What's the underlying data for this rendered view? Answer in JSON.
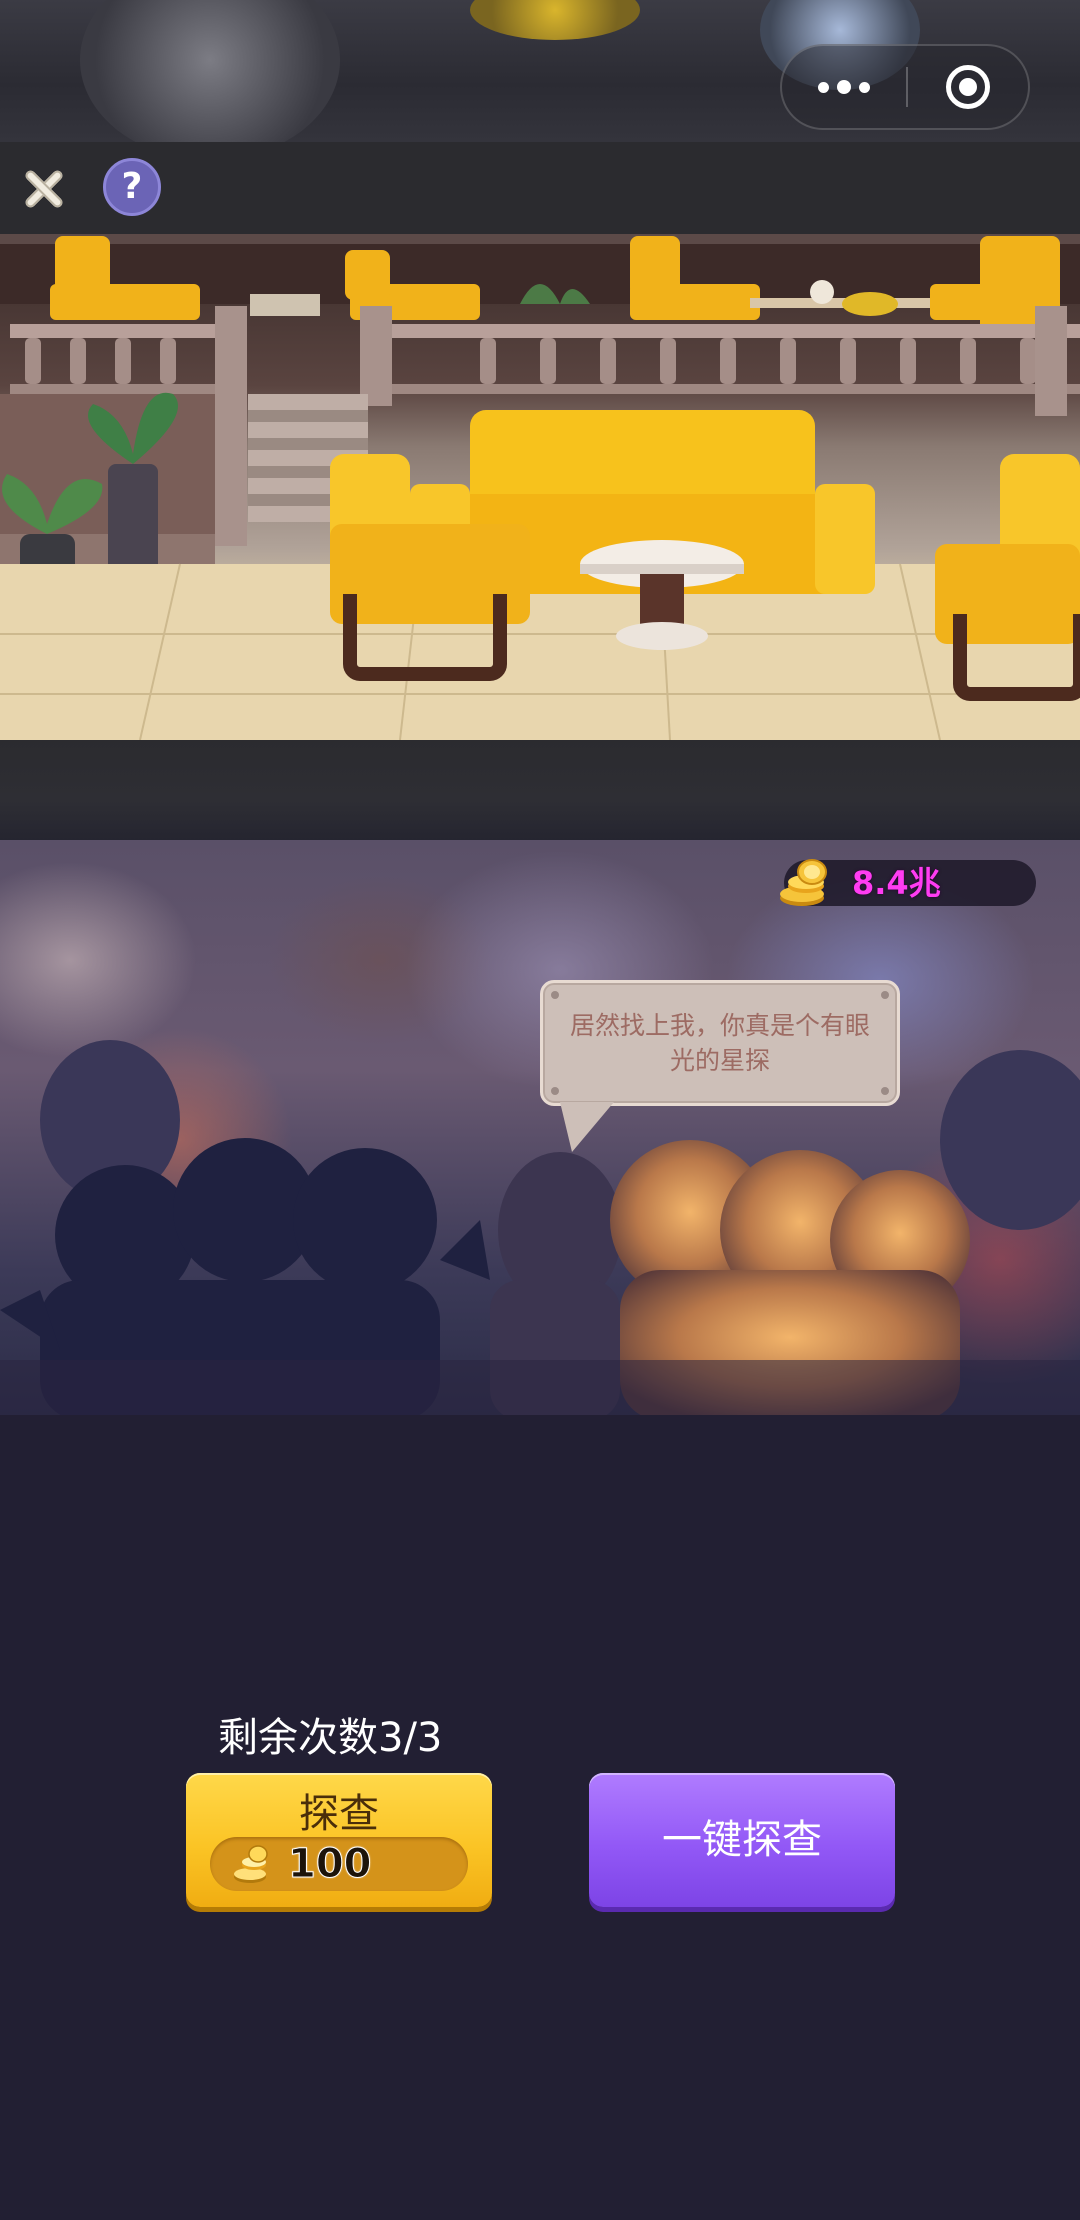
{
  "capsule": {
    "more_icon": "more-dots-icon",
    "target_icon": "target-icon"
  },
  "toolbar": {
    "close_icon": "close-icon",
    "help_label": "?"
  },
  "crowd_scene": {
    "coins": "8.4兆",
    "speech": "居然找上我，你真是个有眼光的星探"
  },
  "controls": {
    "remaining_label": "剩余次数3/3",
    "probe_label": "探查",
    "probe_cost": "100",
    "auto_probe_label": "一键探查"
  },
  "colors": {
    "coin_text": "#ff3cf2",
    "probe_button": "#fbc425",
    "auto_button": "#9258f6",
    "background": "#221f33"
  }
}
